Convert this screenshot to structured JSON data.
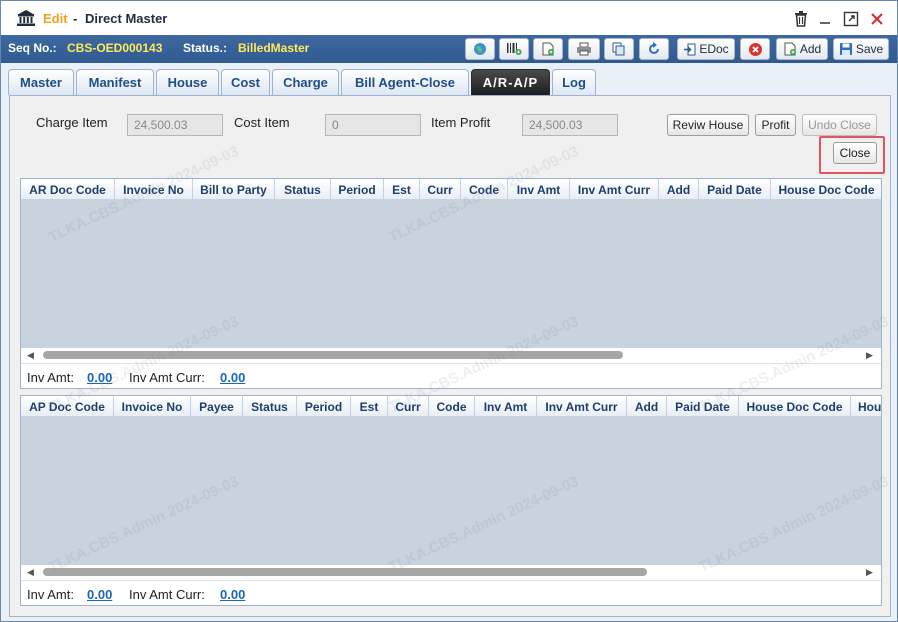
{
  "window": {
    "mode": "Edit",
    "separator": "-",
    "title": "Direct Master",
    "accent_color": "#f0a020"
  },
  "status": {
    "seq_label": "Seq No.:",
    "seq_value": "CBS-OED000143",
    "status_label": "Status.:",
    "status_value": "BilledMaster"
  },
  "toolbar": {
    "edoc_label": "EDoc",
    "add_label": "Add",
    "save_label": "Save"
  },
  "tabs": [
    {
      "label": "Master"
    },
    {
      "label": "Manifest"
    },
    {
      "label": "House"
    },
    {
      "label": "Cost"
    },
    {
      "label": "Charge"
    },
    {
      "label": "Bill Agent-Close"
    },
    {
      "label": "A/R-A/P"
    },
    {
      "label": "Log"
    }
  ],
  "active_tab": "A/R-A/P",
  "fields": {
    "charge_item_label": "Charge Item",
    "charge_item_value": "24,500.03",
    "cost_item_label": "Cost Item",
    "cost_item_value": "0",
    "item_profit_label": "Item Profit",
    "item_profit_value": "24,500.03"
  },
  "actions": {
    "review_house": "Reviw House",
    "profit": "Profit",
    "undo_close": "Undo Close",
    "close": "Close"
  },
  "ar_grid": {
    "columns": [
      "AR Doc Code",
      "Invoice No",
      "Bill to Party",
      "Status",
      "Period",
      "Est",
      "Curr",
      "Code",
      "Inv Amt",
      "Inv Amt Curr",
      "Add",
      "Paid Date",
      "House Doc Code"
    ],
    "footer": {
      "inv_amt_label": "Inv Amt:",
      "inv_amt_value": "0.00",
      "inv_amt_curr_label": "Inv Amt Curr:",
      "inv_amt_curr_value": "0.00"
    }
  },
  "ap_grid": {
    "columns": [
      "AP Doc Code",
      "Invoice No",
      "Payee",
      "Status",
      "Period",
      "Est",
      "Curr",
      "Code",
      "Inv Amt",
      "Inv Amt Curr",
      "Add",
      "Paid Date",
      "House Doc Code",
      "Hou"
    ],
    "footer": {
      "inv_amt_label": "Inv Amt:",
      "inv_amt_value": "0.00",
      "inv_amt_curr_label": "Inv Amt Curr:",
      "inv_amt_curr_value": "0.00"
    }
  },
  "watermark": "TLKA.CBS.Admin 2024-09-03"
}
